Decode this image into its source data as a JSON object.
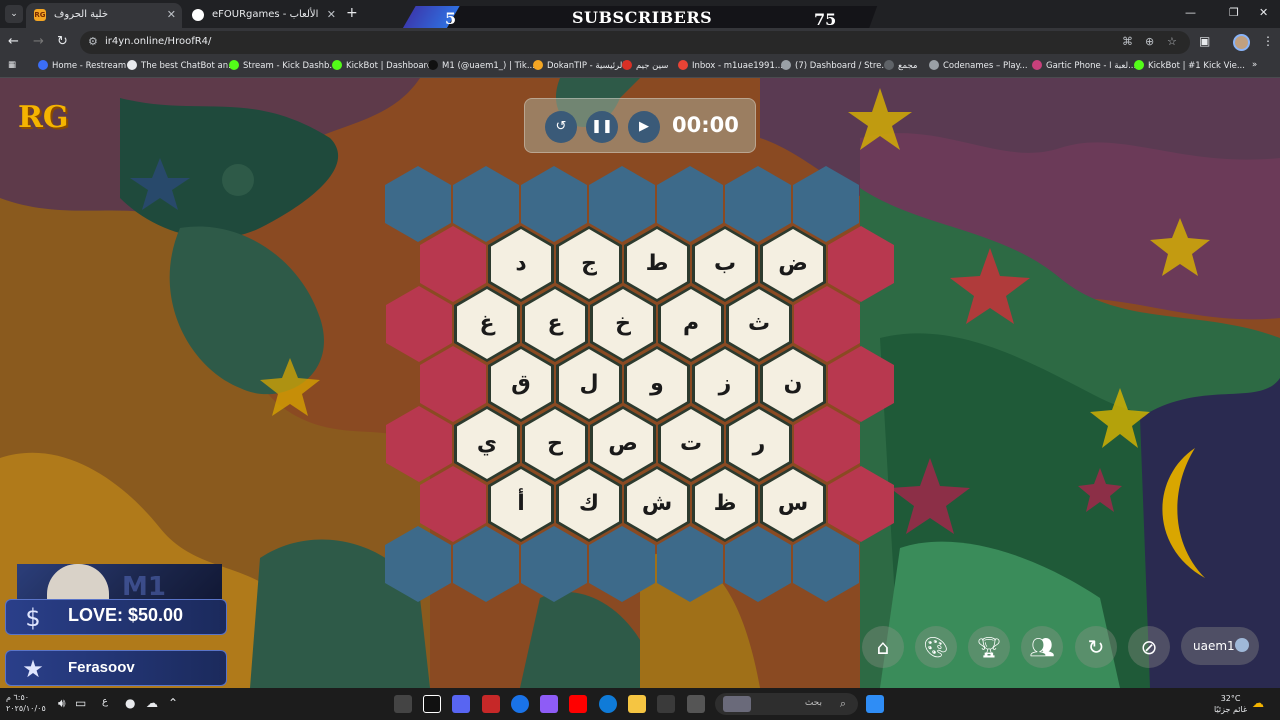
{
  "browser": {
    "tabs": [
      {
        "title": "خلية الحروف",
        "favicon": "RG",
        "active": true
      },
      {
        "title": "eFOURgames - الألعاب",
        "favicon": "",
        "active": false
      }
    ],
    "url": "ir4yn.online/HroofR4/",
    "bookmarks": [
      {
        "label": "Home - Restream",
        "color": "#3b6ef6"
      },
      {
        "label": "The best ChatBot an...",
        "color": "#e8eaed"
      },
      {
        "label": "Stream - Kick Dashb...",
        "color": "#53fc18"
      },
      {
        "label": "KickBot | Dashboard",
        "color": "#53fc18"
      },
      {
        "label": "M1 (@uaem1_) | Tik...",
        "color": "#111111"
      },
      {
        "label": "DokanTIP - الرئيسية",
        "color": "#f5a623"
      },
      {
        "label": "سين جيم",
        "color": "#d93025"
      },
      {
        "label": "Inbox - m1uae1991...",
        "color": "#ea4335"
      },
      {
        "label": "(7) Dashboard / Stre...",
        "color": "#9aa0a6"
      },
      {
        "label": "مجمع",
        "color": "#5f6368"
      },
      {
        "label": "Codenames – Play...",
        "color": "#9aa0a6"
      },
      {
        "label": "Gartic Phone - لعبة ا...",
        "color": "#c7407b"
      },
      {
        "label": "KickBot | #1 Kick Vie...",
        "color": "#53fc18"
      }
    ]
  },
  "subscriber_bar": {
    "left_count": "5",
    "title": "SUBSCRIBERS",
    "right_count": "75"
  },
  "game": {
    "logo": "RG",
    "timer": {
      "time": "00:00",
      "buttons": [
        "reset-icon",
        "pause-icon",
        "play-icon"
      ]
    },
    "rows": [
      [
        "ض",
        "ب",
        "ط",
        "ج",
        "د"
      ],
      [
        "ث",
        "م",
        "خ",
        "ع",
        "غ"
      ],
      [
        "ن",
        "ز",
        "و",
        "ل",
        "ق"
      ],
      [
        "ر",
        "ت",
        "ص",
        "ح",
        "ي"
      ],
      [
        "س",
        "ظ",
        "ش",
        "ك",
        "أ"
      ]
    ],
    "controls": [
      "home-icon",
      "palette-icon",
      "trophy-icon",
      "users-icon",
      "refresh-icon",
      "hide-icon"
    ],
    "username": "uaem1"
  },
  "stream_overlay": {
    "love": "LOVE: $50.00",
    "follower": "Ferasoov"
  },
  "taskbar": {
    "search_label": "بحث",
    "lang": "ع",
    "clock_time": "٦:٥٠ م",
    "clock_date": "٢٠٢٥/١٠/٠٥",
    "weather_temp": "32°C",
    "weather_desc": "غائم جزئيًا"
  },
  "colors": {
    "blue_hex": "#3d6a8a",
    "red_hex": "#b8384f",
    "cell_hex": "#f4efe1"
  }
}
